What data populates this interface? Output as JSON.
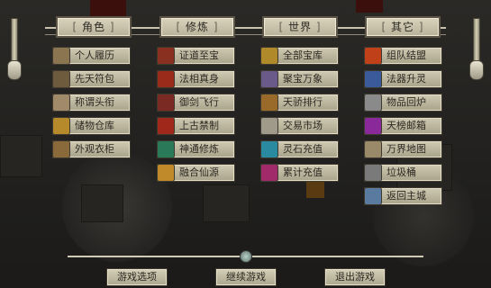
{
  "categories": [
    {
      "label": "角色"
    },
    {
      "label": "修炼"
    },
    {
      "label": "世界"
    },
    {
      "label": "其它"
    }
  ],
  "columns": [
    {
      "items": [
        {
          "label": "个人履历",
          "icon": "scroll-icon"
        },
        {
          "label": "先天符包",
          "icon": "bundle-icon"
        },
        {
          "label": "称谓头衔",
          "icon": "title-scroll-icon"
        },
        {
          "label": "储物仓库",
          "icon": "storage-chest-icon"
        },
        {
          "label": "外观衣柜",
          "icon": "wardrobe-icon"
        }
      ]
    },
    {
      "items": [
        {
          "label": "证道至宝",
          "icon": "treasure-orb-icon"
        },
        {
          "label": "法相真身",
          "icon": "dharma-avatar-icon"
        },
        {
          "label": "御剑飞行",
          "icon": "flying-sword-icon"
        },
        {
          "label": "上古禁制",
          "icon": "ancient-seal-icon"
        },
        {
          "label": "神通修炼",
          "icon": "magic-orb-icon"
        },
        {
          "label": "融合仙源",
          "icon": "immortal-source-icon"
        }
      ]
    },
    {
      "items": [
        {
          "label": "全部宝库",
          "icon": "treasure-box-icon"
        },
        {
          "label": "聚宝万象",
          "icon": "treasure-pot-icon"
        },
        {
          "label": "天骄排行",
          "icon": "ranking-icon"
        },
        {
          "label": "交易市场",
          "icon": "market-scroll-icon"
        },
        {
          "label": "灵石充值",
          "icon": "spirit-stone-icon"
        },
        {
          "label": "累计充值",
          "icon": "cumulative-recharge-icon"
        }
      ]
    },
    {
      "items": [
        {
          "label": "组队结盟",
          "icon": "team-icon"
        },
        {
          "label": "法器升灵",
          "icon": "artifact-upgrade-icon"
        },
        {
          "label": "物品回炉",
          "icon": "recycle-furnace-icon"
        },
        {
          "label": "天榜邮箱",
          "icon": "mailbox-icon"
        },
        {
          "label": "万界地图",
          "icon": "map-icon"
        },
        {
          "label": "垃圾桶",
          "icon": "trash-bin-icon"
        },
        {
          "label": "返回主城",
          "icon": "return-town-icon"
        }
      ]
    }
  ],
  "footer": {
    "options": "游戏选项",
    "continue": "继续游戏",
    "exit": "退出游戏"
  }
}
